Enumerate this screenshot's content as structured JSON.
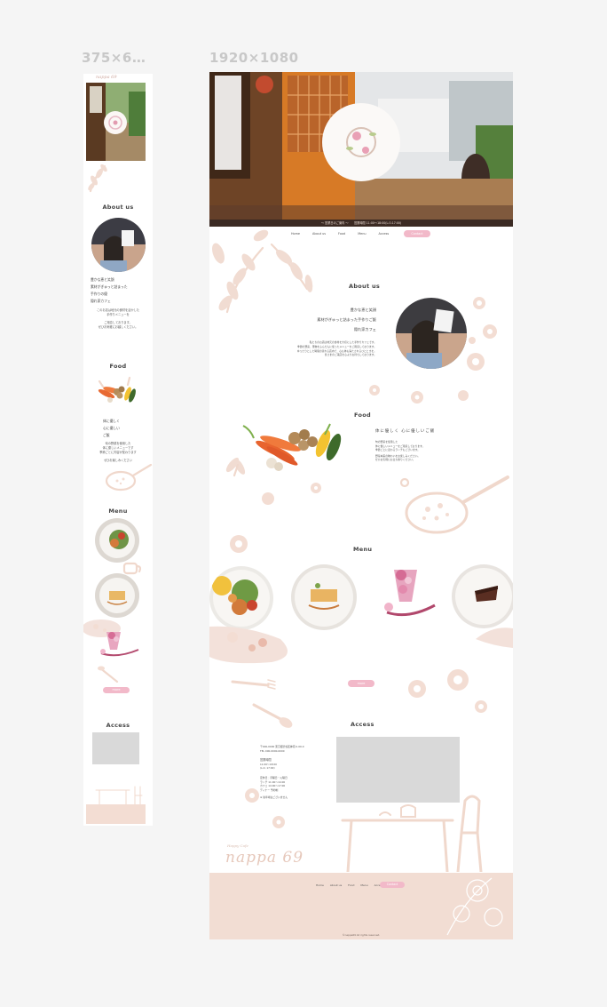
{
  "labels": {
    "mobile_size": "375×6…",
    "desktop_size": "1920×1080"
  },
  "mobile": {
    "logo_text": "nappa 69",
    "about": {
      "title": "About us",
      "heading_lines": [
        "豊かな恵と笑顔",
        "素材がぎゅっと詰まった",
        "手作りの優",
        "隠れ家カフェ"
      ],
      "body_lines": [
        "このお店は地元の食材を活かした",
        "手作りメニューを",
        "ご用意しております。",
        "ぜひお気軽にお越しください。"
      ]
    },
    "food": {
      "title": "Food",
      "heading_lines": [
        "体に優しく",
        "心に優しい",
        "ご飯"
      ],
      "body_lines": [
        "旬の野菜を使用した",
        "体に優しいメニューです",
        "季節ごとに内容が変わります",
        "ぜひお楽しみください"
      ]
    },
    "menu": {
      "title": "Menu",
      "button": "more"
    },
    "access": {
      "title": "Access"
    }
  },
  "desktop": {
    "hero_info": "〜 営業日のご案内 〜　　営業時間 11:00〜18:00(L.O.17:00)",
    "nav": [
      "Home",
      "About us",
      "Food",
      "Menu",
      "Access"
    ],
    "nav_button": "Contact",
    "about": {
      "title": "About us",
      "heading_lines": [
        "豊かな恵と笑顔",
        "素材がぎゅっと詰まった手作りご飯",
        "隠れ家カフェ"
      ],
      "body_lines": [
        "私たちのお店は地元の食材を大切にした手作りカフェです。",
        "季節の野菜、果物をふんだんに使ったメニューをご用意しております。",
        "ゆったりとした時間の流れる店内で、心も体も満たされるひとときを。",
        "皆さまのご来店を心よりお待ちしております。"
      ]
    },
    "food": {
      "title": "Food",
      "heading": "体に優しく 心に優しいご飯",
      "body_lines": [
        "旬の野菜を使用した",
        "体に優しいメニューをご用意しております。",
        "季節ごとに変わるランチもございます。",
        "野菜本来の味わいをお楽しみください。",
        "ぜひお気軽にお立ち寄りください。"
      ]
    },
    "menu": {
      "title": "Menu",
      "button": "more"
    },
    "access": {
      "title": "Access",
      "address_lines": [
        "〒000-0000 東京都渋谷区神南 0-00-0",
        "TEL 000-0000-0000"
      ],
      "hours_title": "営業時間",
      "hours_lines": [
        "11:00〜18:00",
        "(L.O. 17:00)"
      ],
      "holiday_lines": [
        "定休日：月曜日・火曜日",
        "ランチ 11:00〜14:00",
        "カフェ 14:00〜17:00",
        "ディナー 予約制"
      ],
      "note": "※ 駐車場はございません"
    },
    "footer": {
      "logo_script": "Happy Cafe",
      "logo_text": "nappa 69",
      "nav": [
        "Home",
        "About us",
        "Food",
        "Menu",
        "Access"
      ],
      "button": "Contact",
      "copyright": "©nappa69 All rights reserved."
    }
  }
}
